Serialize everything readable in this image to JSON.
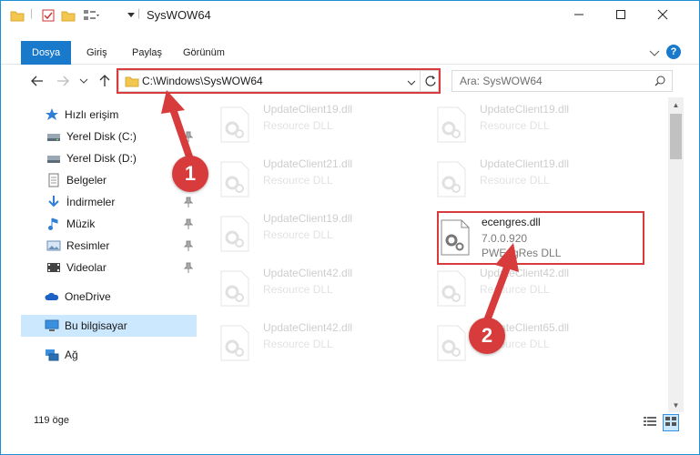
{
  "window": {
    "title": "SysWOW64"
  },
  "ribbon": {
    "tabs": [
      "Dosya",
      "Giriş",
      "Paylaş",
      "Görünüm"
    ]
  },
  "address": {
    "path": "C:\\Windows\\SysWOW64",
    "search_placeholder": "Ara: SysWOW64"
  },
  "nav": {
    "items": [
      {
        "label": "Hızlı erişim",
        "icon": "star-icon"
      },
      {
        "label": "Yerel Disk (C:)",
        "icon": "drive-icon"
      },
      {
        "label": "Yerel Disk (D:)",
        "icon": "drive-icon"
      },
      {
        "label": "Belgeler",
        "icon": "documents-icon"
      },
      {
        "label": "İndirmeler",
        "icon": "downloads-icon"
      },
      {
        "label": "Müzik",
        "icon": "music-icon"
      },
      {
        "label": "Resimler",
        "icon": "pictures-icon"
      },
      {
        "label": "Videolar",
        "icon": "videos-icon"
      },
      {
        "label": "OneDrive",
        "icon": "onedrive-icon"
      },
      {
        "label": "Bu bilgisayar",
        "icon": "computer-icon"
      },
      {
        "label": "Ağ",
        "icon": "network-icon"
      }
    ]
  },
  "files": [
    {
      "name": "UpdateClient19.dll",
      "type": "Resource DLL"
    },
    {
      "name": "UpdateClient19.dll",
      "type": "Resource DLL"
    },
    {
      "name": "UpdateClient21.dll",
      "type": "Resource DLL"
    },
    {
      "name": "UpdateClient19.dll",
      "type": "Resource DLL"
    },
    {
      "name": "UpdateClient19.dll",
      "type": "Resource DLL"
    },
    {
      "name": "ecengres.dll",
      "version": "7.0.0.920",
      "type": "PWEngRes DLL"
    },
    {
      "name": "UpdateClient42.dll",
      "type": "Resource DLL"
    },
    {
      "name": "UpdateClient42.dll",
      "type": "Resource DLL"
    },
    {
      "name": "UpdateClient42.dll",
      "type": "Resource DLL"
    },
    {
      "name": "UpdateClient65.dll",
      "type": "Resource DLL"
    }
  ],
  "status": {
    "item_count": "119 öge"
  },
  "annotations": {
    "step1": "1",
    "step2": "2"
  },
  "colors": {
    "accent": "#1979ca",
    "highlight": "#d83b3b",
    "selected": "#cce8ff"
  }
}
